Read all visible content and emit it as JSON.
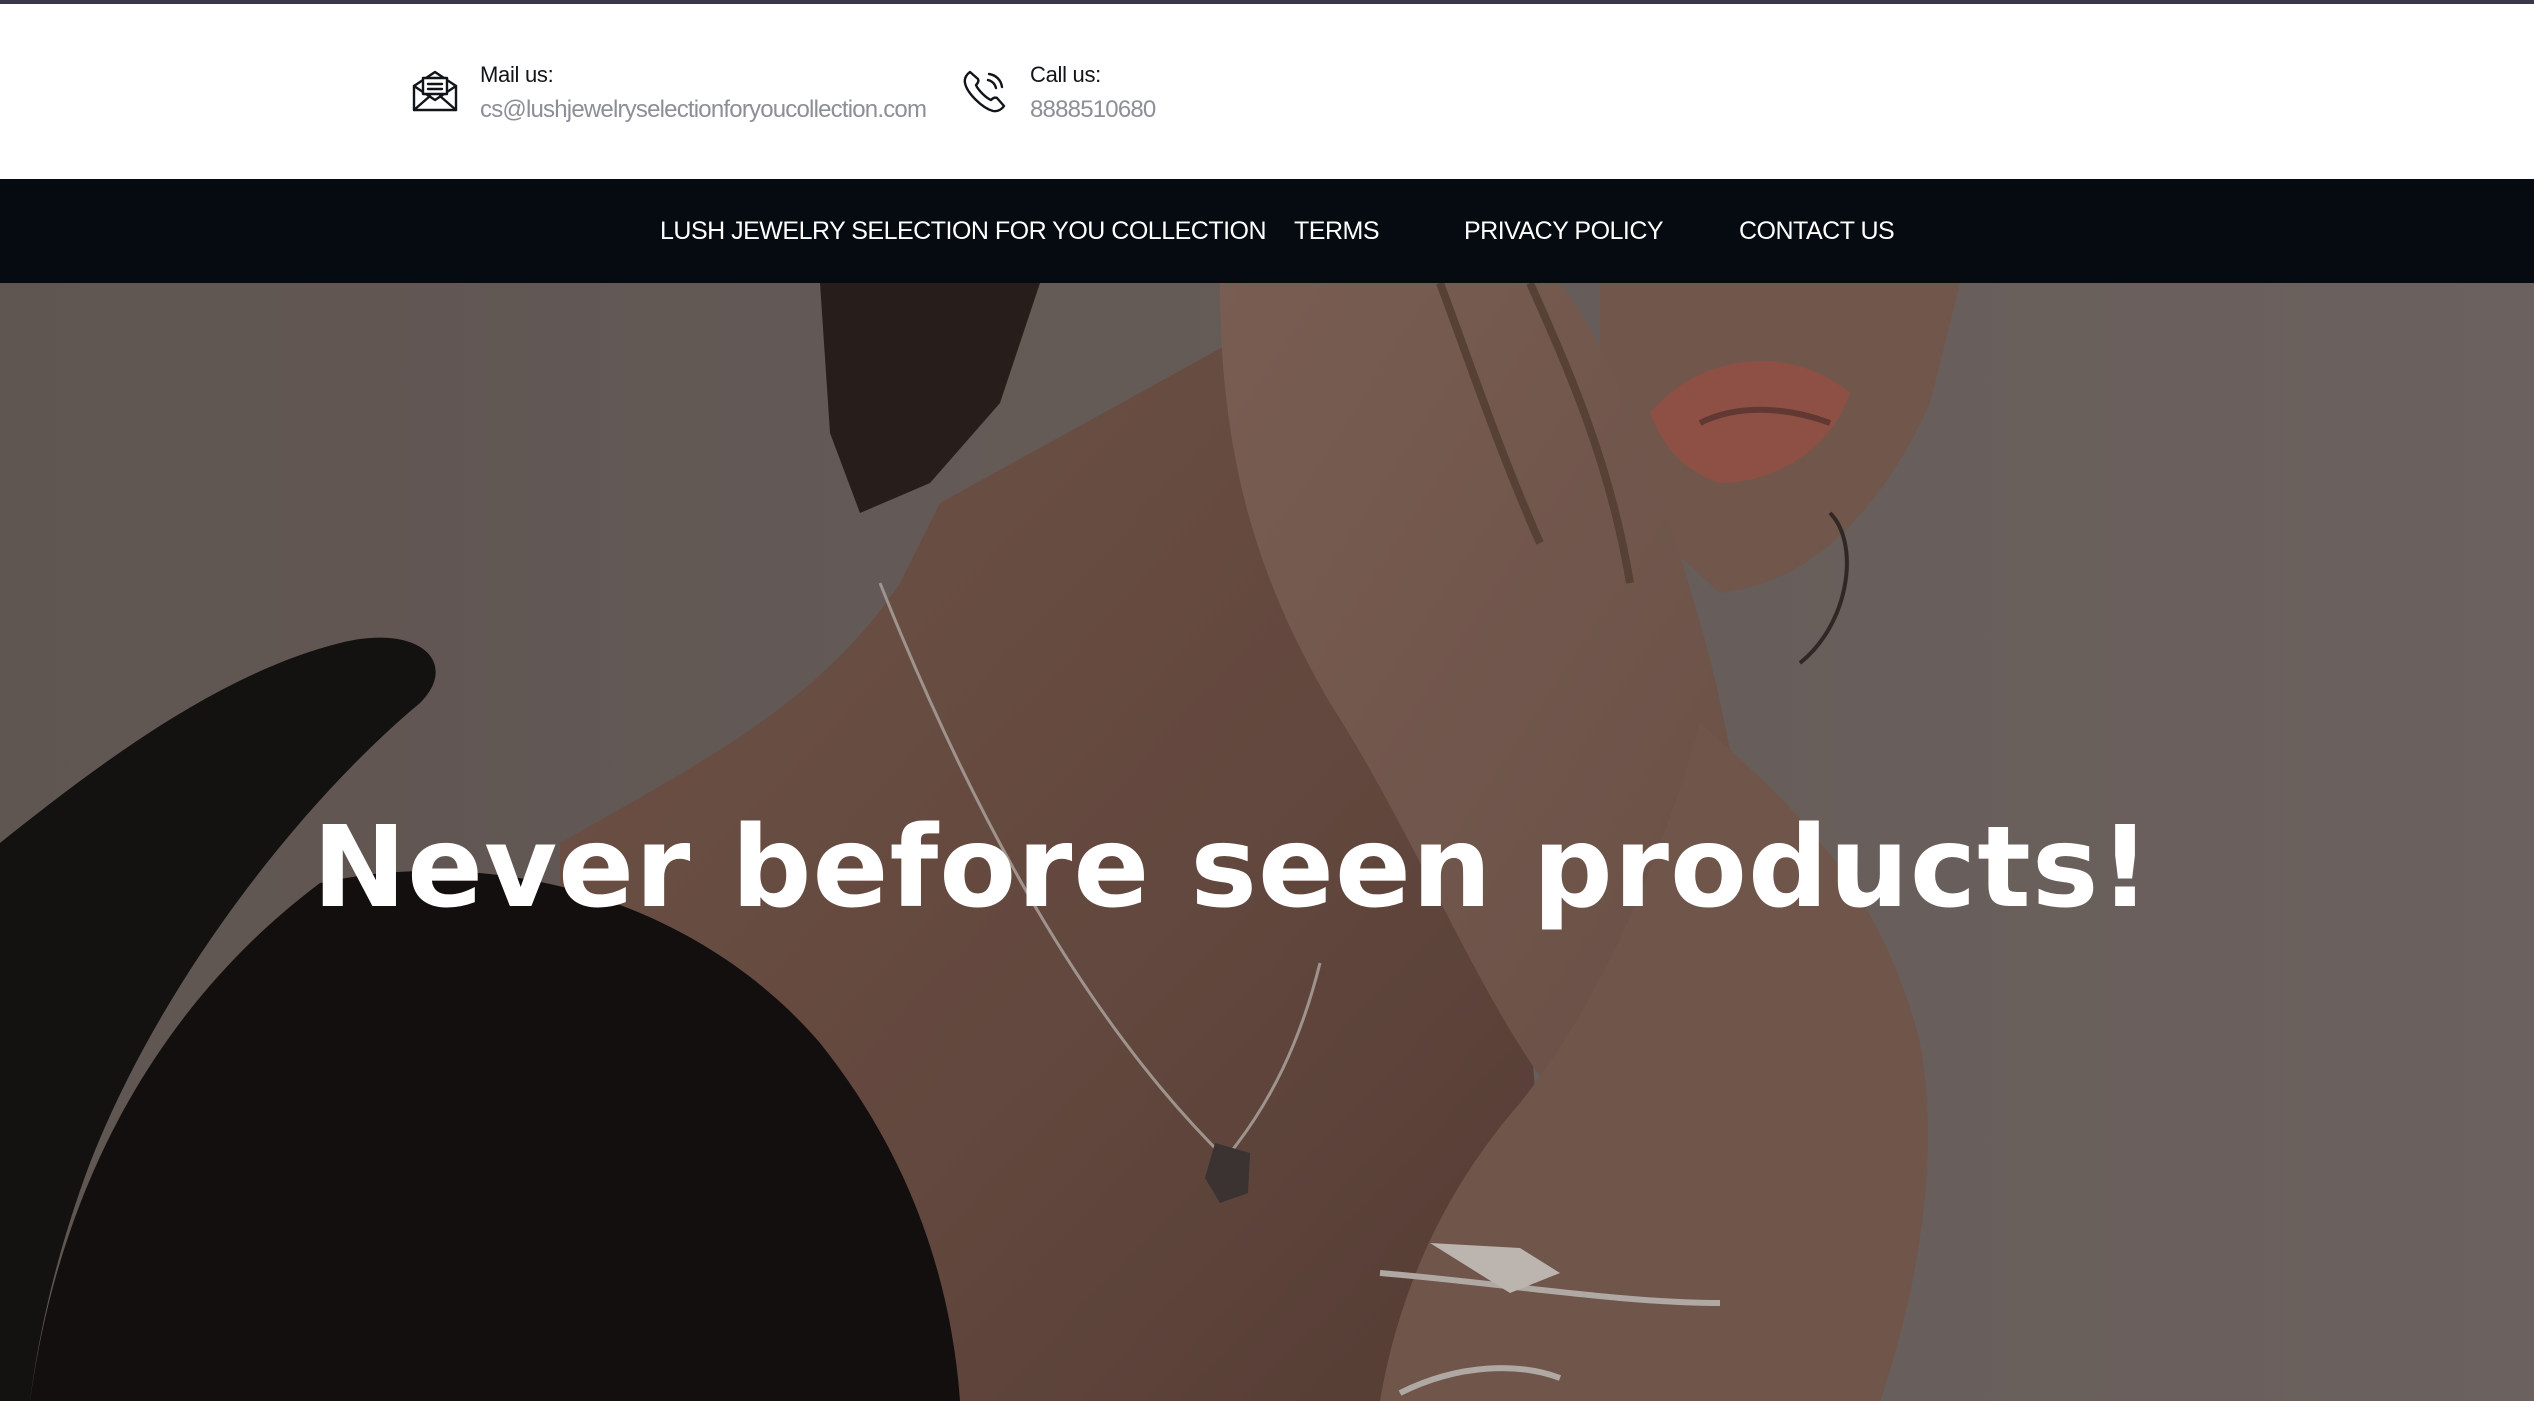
{
  "header": {
    "mail": {
      "label": "Mail us:",
      "value": "cs@lushjewelryselectionforyoucollection.com",
      "icon": "envelope-icon"
    },
    "call": {
      "label": "Call us:",
      "value": "8888510680",
      "icon": "phone-icon"
    }
  },
  "nav": {
    "items": [
      {
        "label": "LUSH JEWELRY SELECTION FOR YOU COLLECTION"
      },
      {
        "label": "TERMS"
      },
      {
        "label": "PRIVACY POLICY"
      },
      {
        "label": "CONTACT US"
      }
    ]
  },
  "hero": {
    "heading": "Never before seen products!"
  },
  "colors": {
    "nav_background": "#050b10",
    "hero_overlay": "#3b3230",
    "text_light": "#ffffff",
    "contact_value": "#8c8f96"
  }
}
